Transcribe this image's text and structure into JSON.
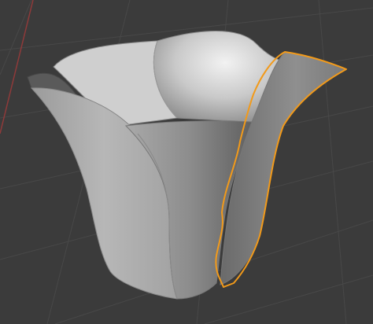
{
  "editor": {
    "type": "3D Viewport",
    "view": "perspective",
    "shading": "solid"
  },
  "scene": {
    "object": "tulip-flower-mesh",
    "selected_part": "front-right-petal-outline",
    "colors": {
      "background": "#3b3b3b",
      "grid": "#4a4a4a",
      "x_axis": "#9a3b3b",
      "mesh_light": "#d9d9d9",
      "mesh_mid": "#a9a9a9",
      "mesh_dark": "#5f5f5f",
      "selection": "#f29a1a"
    }
  }
}
